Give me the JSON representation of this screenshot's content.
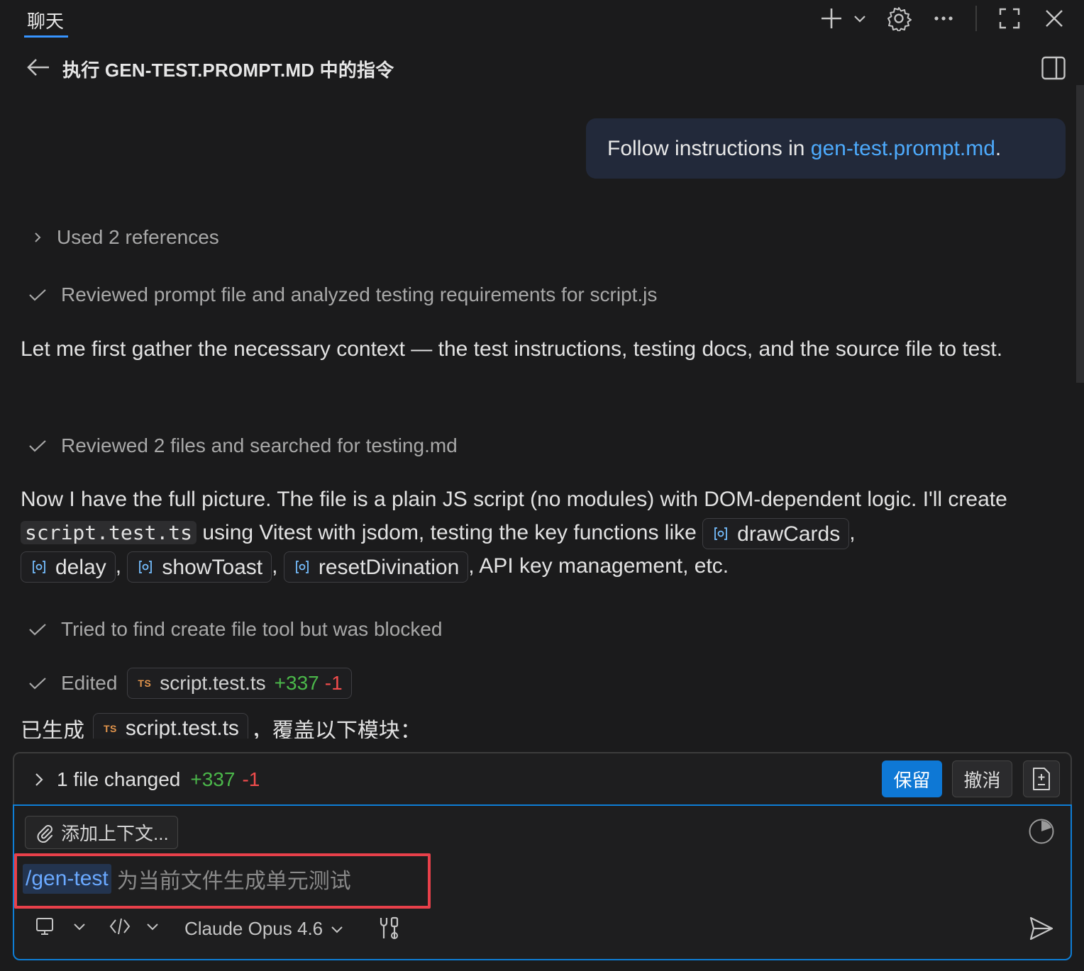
{
  "tab": {
    "title": "聊天"
  },
  "header": {
    "title": "执行 GEN-TEST.PROMPT.MD 中的指令"
  },
  "user_message": {
    "prefix": "Follow instructions in ",
    "link": "gen-test.prompt.md",
    "suffix": "."
  },
  "steps": {
    "references": "Used 2 references",
    "reviewed_prompt": "Reviewed prompt file and analyzed testing requirements for script.js",
    "reviewed_files": "Reviewed 2 files and searched for testing.md",
    "tried_tool": "Tried to find create file tool but was blocked",
    "edited_label": "Edited"
  },
  "paragraph1": "Let me first gather the necessary context — the test instructions, testing docs, and the source file to test.",
  "paragraph2": {
    "part1": "Now I have the full picture. The file is a plain JS script (no modules) with DOM-dependent logic. I'll create ",
    "code": "script.test.ts",
    "part2": " using Vitest with jsdom, testing the key functions like ",
    "comma": ",",
    "fn1": "drawCards",
    "fn2": "delay",
    "fn3": "showToast",
    "fn4": "resetDivination",
    "tail": ", API key management, etc."
  },
  "edited_file": {
    "ts_badge": "TS",
    "name": "script.test.ts",
    "added": "+337",
    "removed": "-1"
  },
  "summary_line": {
    "prefix": "已生成",
    "file": "script.test.ts",
    "suffix": "，覆盖以下模块："
  },
  "changes": {
    "label": "1 file changed",
    "added": "+337",
    "removed": "-1",
    "keep": "保留",
    "undo": "撤消"
  },
  "input": {
    "add_context": "添加上下文...",
    "slash_command": "/gen-test",
    "placeholder": "为当前文件生成单元测试",
    "model": "Claude Opus 4.6"
  },
  "colors": {
    "accent": "#0e78d5",
    "link": "#4daafc",
    "added": "#4bb74a",
    "removed": "#f14c4c",
    "highlight": "#e8404a"
  },
  "icons": [
    "plus-icon",
    "chevron-down-icon",
    "gear-icon",
    "more-icon",
    "maximize-icon",
    "close-icon",
    "back-arrow-icon",
    "split-view-icon",
    "chevron-right-icon",
    "check-icon",
    "symbol-method-icon",
    "paperclip-icon",
    "context-usage-icon",
    "monitor-icon",
    "code-icon",
    "tools-icon",
    "send-icon",
    "diff-icon"
  ]
}
